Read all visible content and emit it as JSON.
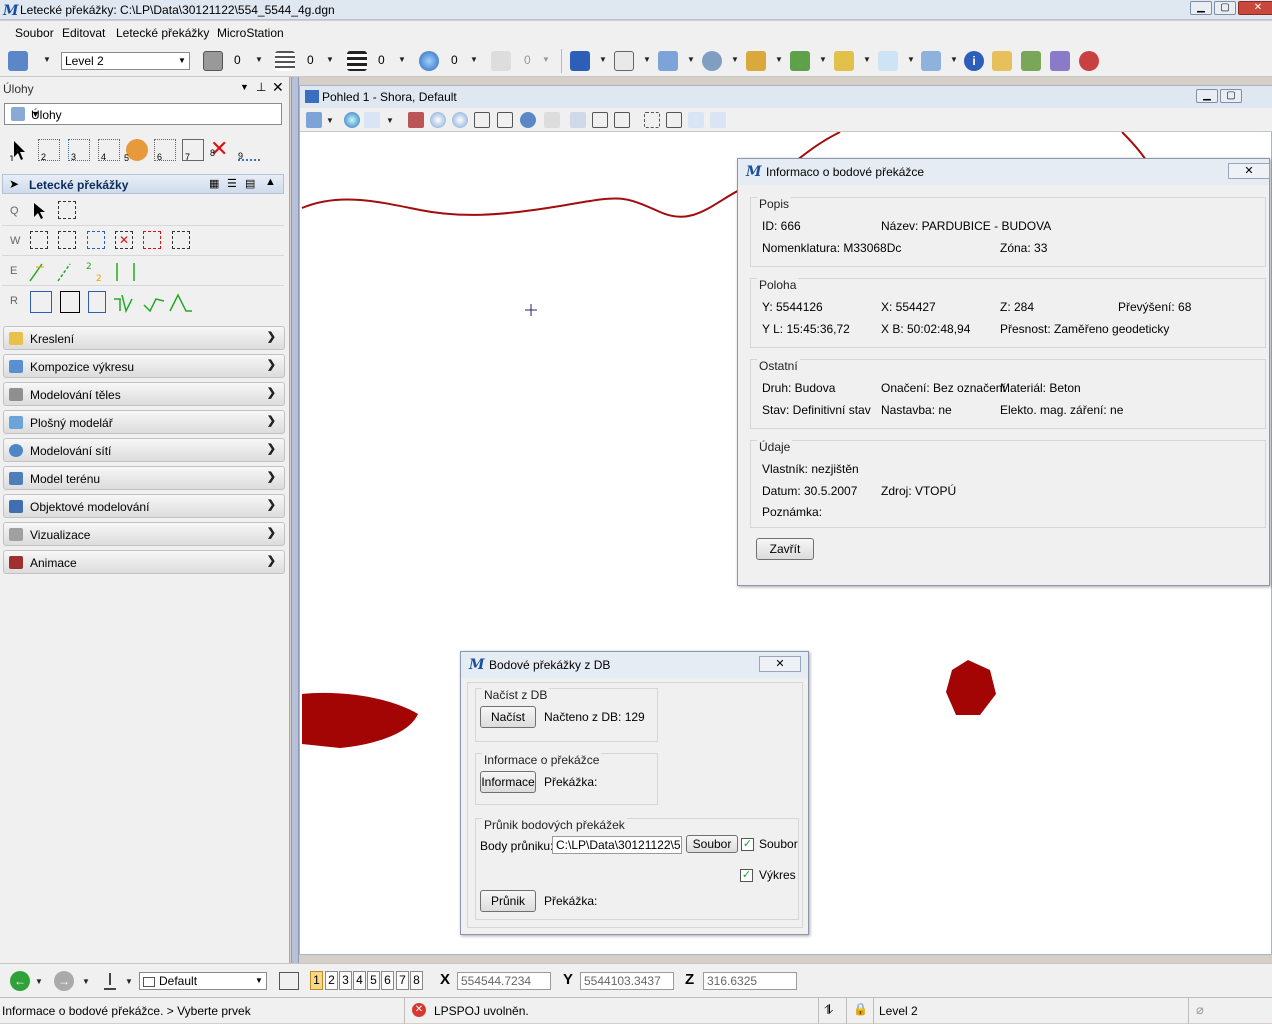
{
  "app": {
    "title": "Letecké překážky:  C:\\LP\\Data\\30121122\\554_5544_4g.dgn"
  },
  "menu": [
    "Soubor",
    "Editovat",
    "Letecké překážky",
    "MicroStation"
  ],
  "toolbar": {
    "level": "Level 2",
    "counts": [
      "0",
      "0",
      "0",
      "0",
      "0"
    ]
  },
  "left_panel": {
    "header": "Úlohy",
    "task_combo": "Úlohy",
    "tool_numbers": [
      "1",
      "2",
      "3",
      "4",
      "5",
      "6",
      "7",
      "8",
      "9"
    ],
    "section_title": "Letecké překážky",
    "row_keys": [
      "Q",
      "W",
      "E",
      "R"
    ],
    "accordion": [
      {
        "label": "Kreslení",
        "color": "#e8c04a"
      },
      {
        "label": "Kompozice výkresu",
        "color": "#5a8fd0"
      },
      {
        "label": "Modelování těles",
        "color": "#8f8f8f"
      },
      {
        "label": "Plošný modelář",
        "color": "#6ca3d8"
      },
      {
        "label": "Modelování sítí",
        "color": "#4f86c6"
      },
      {
        "label": "Model terénu",
        "color": "#4f7fb8"
      },
      {
        "label": "Objektové modelování",
        "color": "#3f6fb0"
      },
      {
        "label": "Vizualizace",
        "color": "#a0a0a0"
      },
      {
        "label": "Animace",
        "color": "#a03030"
      }
    ]
  },
  "view": {
    "title": "Pohled 1 - Shora, Default"
  },
  "info_dialog": {
    "title": "Informaco o bodové překážce",
    "close_icon": "close-icon",
    "popis": {
      "label": "Popis",
      "id": "ID: 666",
      "nazev": "Název: PARDUBICE - BUDOVA",
      "nomenklatura": "Nomenklatura: M33068Dc",
      "zona": "Zóna: 33"
    },
    "poloha": {
      "label": "Poloha",
      "y": "Y: 5544126",
      "x": "X: 554427",
      "z": "Z: 284",
      "prevyseni": "Převýšení: 68",
      "yl": "Y L: 15:45:36,72",
      "xb": "X B: 50:02:48,94",
      "presnost": "Přesnost: Zaměřeno geodeticky"
    },
    "ostatni": {
      "label": "Ostatní",
      "druh": "Druh: Budova",
      "onaceni": "Onačení: Bez označení",
      "material": "Materiál: Beton",
      "stav": "Stav: Definitivní stav",
      "nastavba": "Nastavba: ne",
      "elekto": "Elekto. mag. záření: ne"
    },
    "udaje": {
      "label": "Údaje",
      "vlastnik": "Vlastník: nezjištěn",
      "datum": "Datum: 30.5.2007",
      "zdroj": "Zdroj: VTOPÚ",
      "poznamka": "Poznámka:"
    },
    "close_button": "Zavřít"
  },
  "db_dialog": {
    "title": "Bodové překážky z DB",
    "nacist_group": "Načíst z DB",
    "nacist_button": "Načíst",
    "nacteno": "Načteno z DB: 129",
    "info_group": "Informace o překážce",
    "info_button": "Informace",
    "prekazka1": "Překážka:",
    "prunik_group": "Průnik bodových překážek",
    "body_label": "Body průniku:",
    "body_value": "C:\\LP\\Data\\30121122\\5",
    "soubor_button": "Soubor",
    "soubor_chk": "Soubor",
    "vykres_chk": "Výkres",
    "prunik_button": "Průnik",
    "prekazka2": "Překážka:"
  },
  "bottom": {
    "view_combo": "Default",
    "views": [
      "1",
      "2",
      "3",
      "4",
      "5",
      "6",
      "7",
      "8"
    ],
    "x_label": "X",
    "x_value": "554544.7234",
    "y_label": "Y",
    "y_value": "5544103.3437",
    "z_label": "Z",
    "z_value": "316.6325"
  },
  "status": {
    "prompt": "Informace o bodové překážce. > Vyberte prvek",
    "message": "LPSPOJ uvolněn.",
    "level": "Level 2"
  }
}
